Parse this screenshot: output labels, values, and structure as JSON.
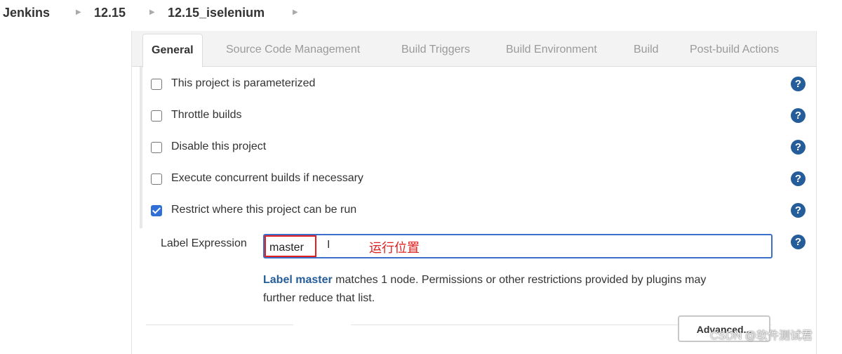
{
  "breadcrumb": {
    "items": [
      "Jenkins",
      "12.15",
      "12.15_iselenium"
    ]
  },
  "tabs": [
    {
      "label": "General",
      "active": true
    },
    {
      "label": "Source Code Management",
      "active": false
    },
    {
      "label": "Build Triggers",
      "active": false
    },
    {
      "label": "Build Environment",
      "active": false
    },
    {
      "label": "Build",
      "active": false
    },
    {
      "label": "Post-build Actions",
      "active": false
    }
  ],
  "options": [
    {
      "label": "This project is parameterized",
      "checked": false
    },
    {
      "label": "Throttle builds",
      "checked": false
    },
    {
      "label": "Disable this project",
      "checked": false
    },
    {
      "label": "Execute concurrent builds if necessary",
      "checked": false
    },
    {
      "label": "Restrict where this project can be run",
      "checked": true
    }
  ],
  "help_glyph": "?",
  "label_expression": {
    "label": "Label Expression",
    "value": "master",
    "annotation": "运行位置"
  },
  "info": {
    "link_text": "Label master",
    "line1_rest": " matches 1 node. Permissions or other restrictions provided by plugins may",
    "line2": "further reduce that list."
  },
  "advanced_button": "Advanced...",
  "watermark": "CSDN @软件测试君",
  "colors": {
    "accent": "#245d9a",
    "annotation": "#e02020",
    "checkbox": "#2f6fd6"
  }
}
